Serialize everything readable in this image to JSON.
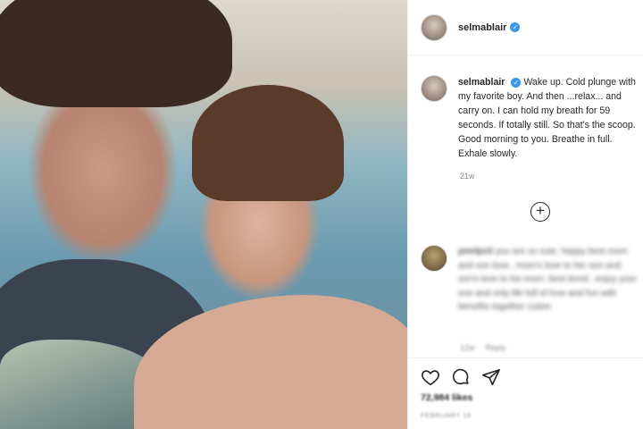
{
  "post": {
    "username": "selmablair",
    "verified_glyph": "✓",
    "caption_user": "selmablair",
    "caption_text": "Wake up. Cold plunge with my favorite boy. And then ...relax... and carry on. I can hold my breath for 59 seconds. If totally still. So that's the scoop. Good morning to you. Breathe in full. Exhale slowly.",
    "timestamp": "21w",
    "add_glyph": "+"
  },
  "comment": {
    "username": "pmrlpcli",
    "text": "you are so cute. happy best mom and son love.. mom's love to her son and son's love to his mom. best bond.. enjoy your one and only life full of love and fun with benefits together cutiee",
    "time": "12w",
    "reply_label": "Reply"
  },
  "footer": {
    "likes": "72,984 likes",
    "date": "FEBRUARY 18"
  },
  "icons": {
    "like": "heart-icon",
    "comment": "comment-icon",
    "share": "share-icon"
  },
  "colors": {
    "verified": "#3897f0",
    "text": "#262626",
    "muted": "#8e8e8e",
    "divider": "#efefef"
  }
}
